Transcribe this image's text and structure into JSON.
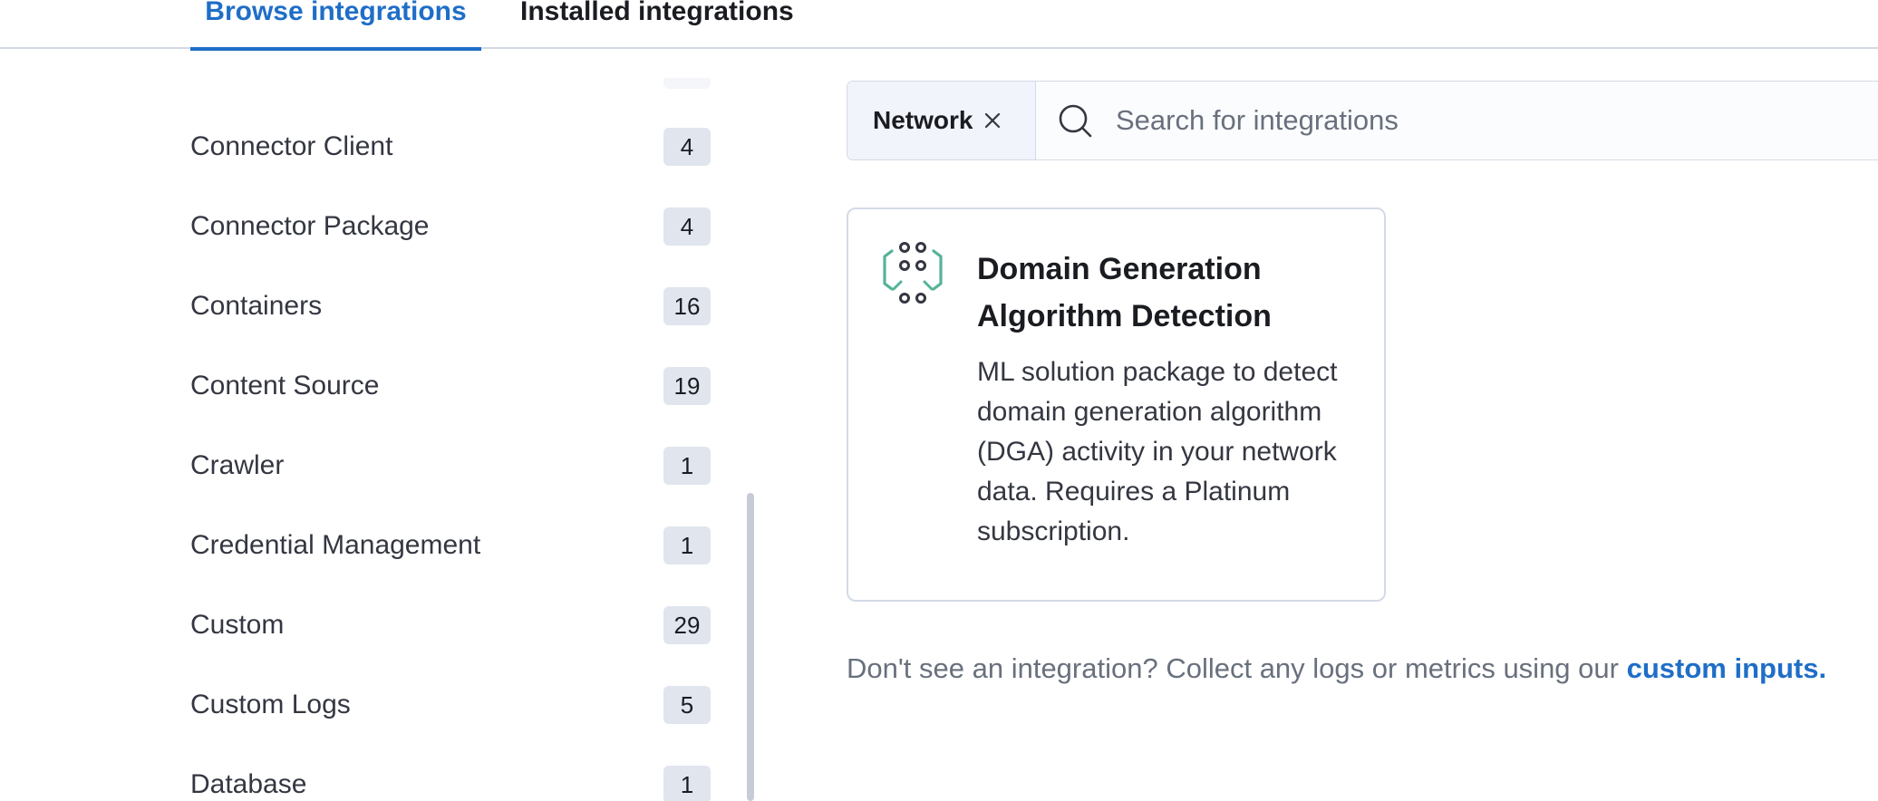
{
  "tabs": {
    "browse": "Browse integrations",
    "installed": "Installed integrations"
  },
  "categories": [
    {
      "label": "Connector Client",
      "count": "4"
    },
    {
      "label": "Connector Package",
      "count": "4"
    },
    {
      "label": "Containers",
      "count": "16"
    },
    {
      "label": "Content Source",
      "count": "19"
    },
    {
      "label": "Crawler",
      "count": "1"
    },
    {
      "label": "Credential Management",
      "count": "1"
    },
    {
      "label": "Custom",
      "count": "29"
    },
    {
      "label": "Custom Logs",
      "count": "5"
    },
    {
      "label": "Database",
      "count": "1"
    }
  ],
  "search": {
    "filter_chip": "Network",
    "placeholder": "Search for integrations",
    "value": ""
  },
  "card": {
    "title": "Domain Generation Algorithm Detection",
    "description": "ML solution package to detect domain generation algorithm (DGA) activity in your network data. Requires a Platinum subscription.",
    "icon": "dga-detection-icon"
  },
  "footer": {
    "text": "Don't see an integration? Collect any logs or metrics using our",
    "link": "custom inputs."
  },
  "colors": {
    "accent": "#1f6ec7",
    "icon_teal": "#54b399",
    "icon_dark": "#343741"
  }
}
